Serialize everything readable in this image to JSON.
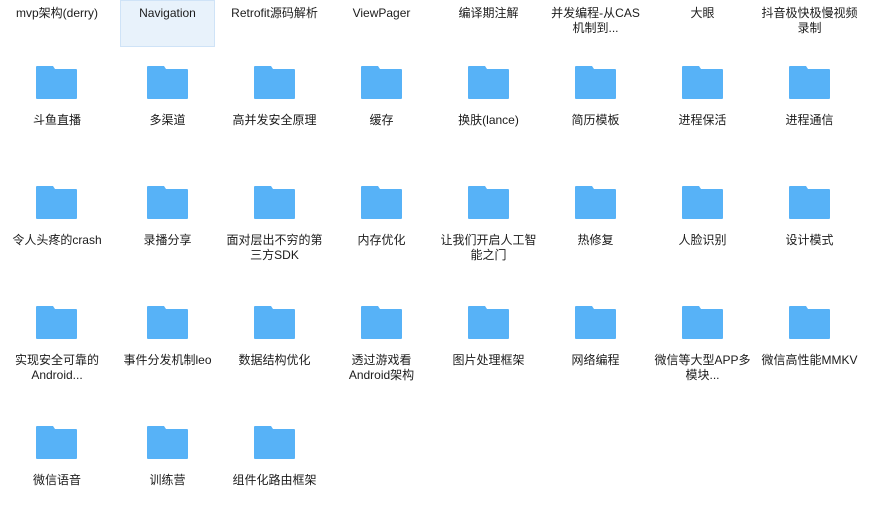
{
  "window": {
    "view": "icon-grid",
    "background_color": "#ffffff",
    "columns": 8
  },
  "theme": {
    "folder_color": "#57b2f7",
    "label_color": "#1b1b1b",
    "selection_fill": "#e8f2fb",
    "selection_border": "#cfe3f7"
  },
  "icons": {
    "folder": "folder-icon"
  },
  "rows": [
    {
      "id": "row-1",
      "icons_visible": false,
      "items": [
        {
          "label": "mvp架构(derry)",
          "selected": false,
          "icon": "folder-icon"
        },
        {
          "label": "Navigation",
          "selected": true,
          "icon": "folder-icon"
        },
        {
          "label": "Retrofit源码解析",
          "selected": false,
          "icon": "folder-icon"
        },
        {
          "label": "ViewPager",
          "selected": false,
          "icon": "folder-icon"
        },
        {
          "label": "编译期注解",
          "selected": false,
          "icon": "folder-icon"
        },
        {
          "label": "并发编程-从CAS机制到...",
          "selected": false,
          "icon": "folder-icon"
        },
        {
          "label": "大眼",
          "selected": false,
          "icon": "folder-icon"
        },
        {
          "label": "抖音极快极慢视频录制",
          "selected": false,
          "icon": "folder-icon"
        }
      ]
    },
    {
      "id": "row-2",
      "icons_visible": true,
      "items": [
        {
          "label": "斗鱼直播",
          "selected": false,
          "icon": "folder-icon"
        },
        {
          "label": "多渠道",
          "selected": false,
          "icon": "folder-icon"
        },
        {
          "label": "高并发安全原理",
          "selected": false,
          "icon": "folder-icon"
        },
        {
          "label": "缓存",
          "selected": false,
          "icon": "folder-icon"
        },
        {
          "label": "换肤(lance)",
          "selected": false,
          "icon": "folder-icon"
        },
        {
          "label": "简历模板",
          "selected": false,
          "icon": "folder-icon"
        },
        {
          "label": "进程保活",
          "selected": false,
          "icon": "folder-icon"
        },
        {
          "label": "进程通信",
          "selected": false,
          "icon": "folder-icon"
        }
      ]
    },
    {
      "id": "row-3",
      "icons_visible": true,
      "items": [
        {
          "label": "令人头疼的crash",
          "selected": false,
          "icon": "folder-icon"
        },
        {
          "label": "录播分享",
          "selected": false,
          "icon": "folder-icon"
        },
        {
          "label": "面对层出不穷的第三方SDK",
          "selected": false,
          "icon": "folder-icon"
        },
        {
          "label": "内存优化",
          "selected": false,
          "icon": "folder-icon"
        },
        {
          "label": "让我们开启人工智能之门",
          "selected": false,
          "icon": "folder-icon"
        },
        {
          "label": "热修复",
          "selected": false,
          "icon": "folder-icon"
        },
        {
          "label": "人脸识别",
          "selected": false,
          "icon": "folder-icon"
        },
        {
          "label": "设计模式",
          "selected": false,
          "icon": "folder-icon"
        }
      ]
    },
    {
      "id": "row-4",
      "icons_visible": true,
      "items": [
        {
          "label": "实现安全可靠的Android...",
          "selected": false,
          "icon": "folder-icon"
        },
        {
          "label": "事件分发机制leo",
          "selected": false,
          "icon": "folder-icon"
        },
        {
          "label": "数据结构优化",
          "selected": false,
          "icon": "folder-icon"
        },
        {
          "label": "透过游戏看Android架构",
          "selected": false,
          "icon": "folder-icon"
        },
        {
          "label": "图片处理框架",
          "selected": false,
          "icon": "folder-icon"
        },
        {
          "label": "网络编程",
          "selected": false,
          "icon": "folder-icon"
        },
        {
          "label": "微信等大型APP多模块...",
          "selected": false,
          "icon": "folder-icon"
        },
        {
          "label": "微信高性能MMKV",
          "selected": false,
          "icon": "folder-icon"
        }
      ]
    },
    {
      "id": "row-5",
      "icons_visible": true,
      "items": [
        {
          "label": "微信语音",
          "selected": false,
          "icon": "folder-icon"
        },
        {
          "label": "训练营",
          "selected": false,
          "icon": "folder-icon"
        },
        {
          "label": "组件化路由框架",
          "selected": false,
          "icon": "folder-icon"
        }
      ]
    }
  ]
}
